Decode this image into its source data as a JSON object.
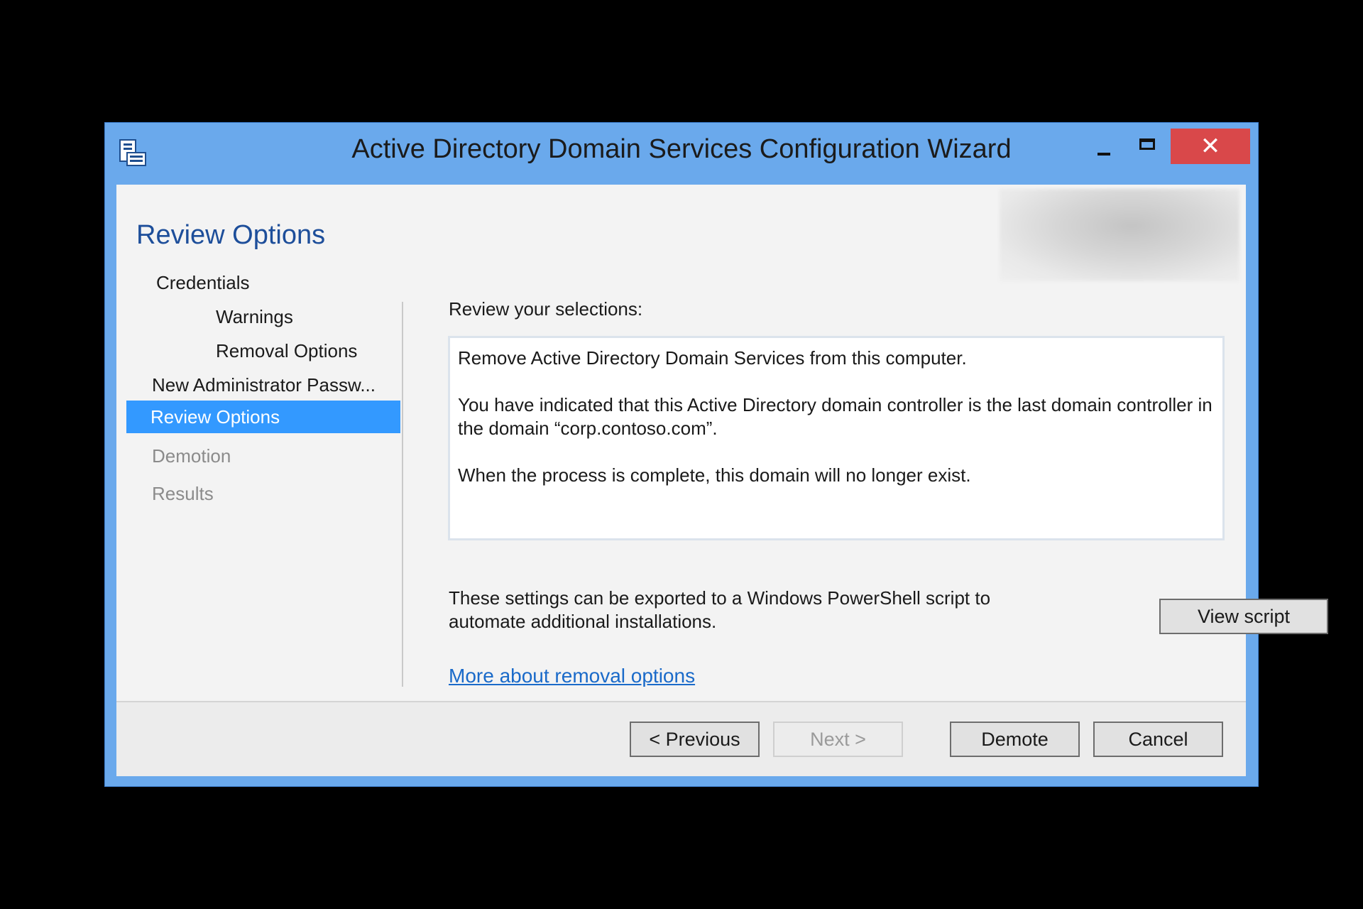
{
  "window": {
    "title": "Active Directory Domain Services Configuration Wizard",
    "close_glyph": "✕"
  },
  "page": {
    "title": "Review Options"
  },
  "nav": {
    "items": [
      {
        "label": "Credentials",
        "state": "normal"
      },
      {
        "label": "Warnings",
        "state": "normal"
      },
      {
        "label": "Removal Options",
        "state": "normal"
      },
      {
        "label": "New Administrator Passw...",
        "state": "normal"
      },
      {
        "label": "Review Options",
        "state": "selected"
      },
      {
        "label": "Demotion",
        "state": "disabled"
      },
      {
        "label": "Results",
        "state": "disabled"
      }
    ]
  },
  "main": {
    "section_label": "Review your selections:",
    "review_lines": [
      "Remove Active Directory Domain Services from this computer.",
      "You have indicated that this Active Directory domain controller is the last domain controller in the domain “corp.contoso.com”.",
      "When the process is complete, this domain will no longer exist."
    ],
    "export_text": "These settings can be exported to a Windows PowerShell script to automate additional installations.",
    "view_script_label": "View script",
    "link_text": "More about removal options"
  },
  "footer": {
    "previous_label": "< Previous",
    "next_label": "Next >",
    "demote_label": "Demote",
    "cancel_label": "Cancel"
  },
  "colors": {
    "title_bar": "#6aa9ec",
    "close_button": "#d9484a",
    "selection": "#3399ff",
    "page_title": "#1d4e9a",
    "link": "#1a6ac9"
  }
}
